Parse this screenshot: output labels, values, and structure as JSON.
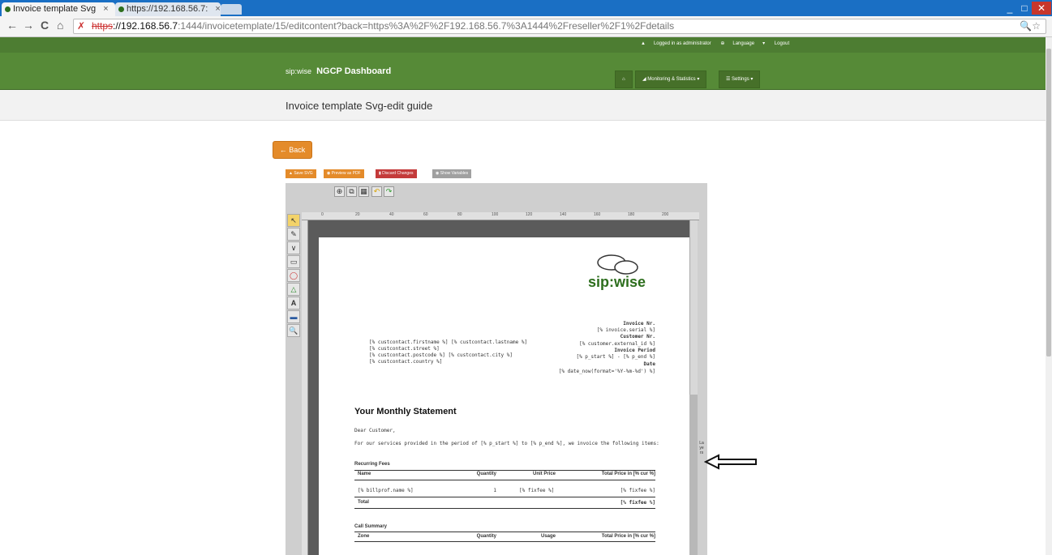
{
  "browser": {
    "tabs": [
      {
        "label": "Invoice template Svg",
        "active": true
      },
      {
        "label": "https://192.168.56.7:",
        "active": false
      }
    ],
    "url": {
      "scheme": "https",
      "host": "://192.168.56.7",
      "rest": ":1444/invoicetemplate/15/editcontent?back=https%3A%2F%2F192.168.56.7%3A1444%2Freseller%2F1%2Fdetails"
    }
  },
  "topnav": {
    "logged_in": "Logged in as administrator",
    "language": "Language",
    "logout": "Logout"
  },
  "brand": {
    "logo": "sip:wise",
    "title": "NGCP Dashboard"
  },
  "nav": {
    "home_icon": "home-icon",
    "monitoring": "Monitoring & Statistics",
    "settings": "Settings"
  },
  "page": {
    "title": "Invoice template Svg-edit guide"
  },
  "back_button": "Back",
  "actions": {
    "save": "Save SVG",
    "preview": "Preview as PDF",
    "discard": "Discard Changes",
    "variables": "Show Variables"
  },
  "editor": {
    "ruler_ticks": [
      "0",
      "20",
      "40",
      "60",
      "80",
      "100",
      "120",
      "140",
      "160",
      "180",
      "200"
    ],
    "layers_label": "Layers"
  },
  "document": {
    "logo_text": "sip:wise",
    "address": [
      "[% custcontact.firstname %] [% custcontact.lastname %]",
      "[% custcontact.street %]",
      "[% custcontact.postcode %] [% custcontact.city %]",
      "[% custcontact.country %]"
    ],
    "invoice_nr_label": "Invoice Nr.",
    "invoice_nr_value": "[% invoice.serial %]",
    "customer_nr_label": "Customer Nr.",
    "customer_nr_value": "[% customer.external_id %]",
    "period_label": "Invoice Period",
    "period_value": "[% p_start %] - [% p_end %]",
    "date_label": "Date",
    "date_value": "[% date_now(format='%Y-%m-%d') %]",
    "heading": "Your Monthly Statement",
    "greeting": "Dear Customer,",
    "intro": "For our services provided in the period of [% p_start %] to [% p_end %], we invoice the following items:",
    "recurring": {
      "title": "Recurring Fees",
      "headers": [
        "Name",
        "Quantity",
        "Unit Price",
        "Total Price in [% cur %]"
      ],
      "row": [
        "[% billprof.name %]",
        "1",
        "[% fixfee %]",
        "[% fixfee %]"
      ],
      "total_label": "Total",
      "total_value": "[% fixfee %]"
    },
    "calls": {
      "title": "Call Summary",
      "headers": [
        "Zone",
        "Quantity",
        "Usage",
        "Total Price in [% cur %]"
      ]
    }
  }
}
